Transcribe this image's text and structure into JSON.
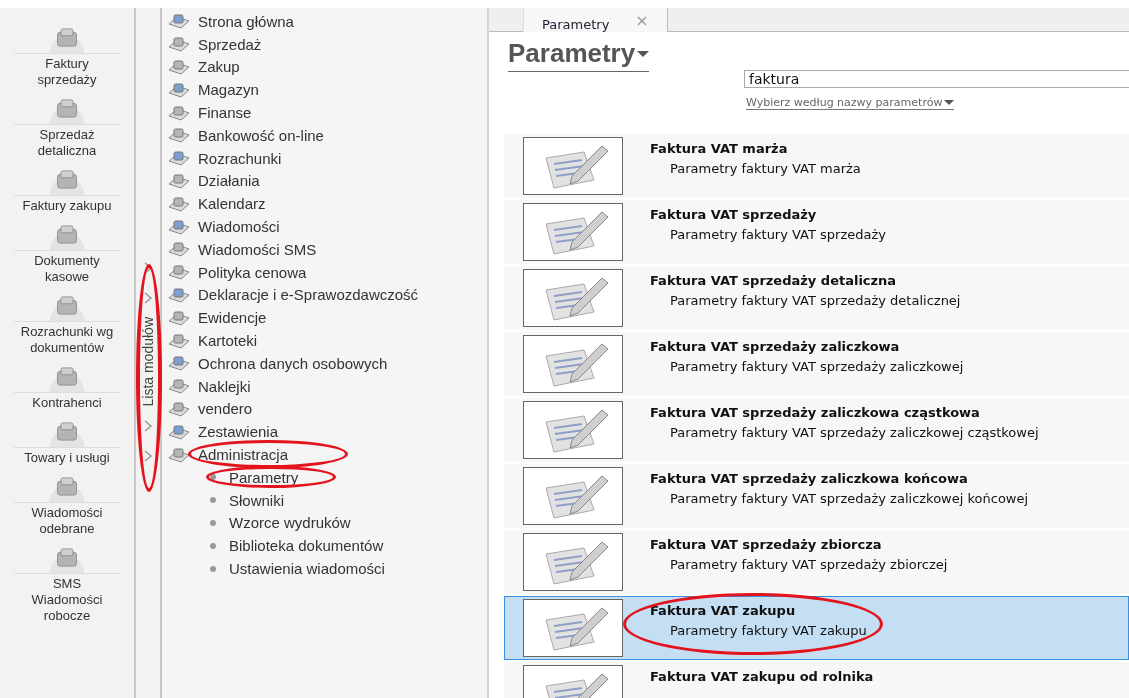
{
  "rail": {
    "items": [
      {
        "label": "Faktury\nsprzedaży"
      },
      {
        "label": "Sprzedaż\ndetaliczna"
      },
      {
        "label": "Faktury zakupu"
      },
      {
        "label": "Dokumenty\nkasowe"
      },
      {
        "label": "Rozrachunki wg\ndokumentów"
      },
      {
        "label": "Kontrahenci"
      },
      {
        "label": "Towary i usługi"
      },
      {
        "label": "Wiadomości\nodebrane"
      },
      {
        "label": "SMS\nWiadomości\nrobocze"
      }
    ]
  },
  "module_list": {
    "label": "Lista modułów",
    "highlighted": true
  },
  "tree": {
    "items": [
      {
        "label": "Strona główna",
        "highlighted": false
      },
      {
        "label": "Sprzedaż",
        "highlighted": false
      },
      {
        "label": "Zakup",
        "highlighted": false
      },
      {
        "label": "Magazyn",
        "highlighted": false
      },
      {
        "label": "Finanse",
        "highlighted": false
      },
      {
        "label": "Bankowość on-line",
        "highlighted": false
      },
      {
        "label": "Rozrachunki",
        "highlighted": false
      },
      {
        "label": "Działania",
        "highlighted": false
      },
      {
        "label": "Kalendarz",
        "highlighted": false
      },
      {
        "label": "Wiadomości",
        "highlighted": false
      },
      {
        "label": "Wiadomości SMS",
        "highlighted": false
      },
      {
        "label": "Polityka cenowa",
        "highlighted": false
      },
      {
        "label": "Deklaracje i e-Sprawozdawczość",
        "highlighted": false
      },
      {
        "label": "Ewidencje",
        "highlighted": false
      },
      {
        "label": "Kartoteki",
        "highlighted": false
      },
      {
        "label": "Ochrona danych osobowych",
        "highlighted": false
      },
      {
        "label": "Naklejki",
        "highlighted": false
      },
      {
        "label": "vendero",
        "highlighted": false
      },
      {
        "label": "Zestawienia",
        "highlighted": false
      },
      {
        "label": "Administracja",
        "highlighted": true,
        "children": [
          {
            "label": "Parametry",
            "highlighted": true
          },
          {
            "label": "Słowniki",
            "highlighted": false
          },
          {
            "label": "Wzorce wydruków",
            "highlighted": false
          },
          {
            "label": "Biblioteka dokumentów",
            "highlighted": false
          },
          {
            "label": "Ustawienia wiadomości",
            "highlighted": false
          }
        ]
      }
    ]
  },
  "tabs": [
    {
      "label": "Parametry",
      "selected": true,
      "close": "×"
    }
  ],
  "page": {
    "title": "Parametry",
    "search": {
      "value": "faktura"
    },
    "filter_link": "Wybierz według nazwy parametrów"
  },
  "results": [
    {
      "title": "Faktura VAT marża",
      "description": "Parametry faktury VAT marża",
      "selected": false,
      "highlighted": false
    },
    {
      "title": "Faktura VAT sprzedaży",
      "description": "Parametry faktury VAT sprzedaży",
      "selected": false,
      "highlighted": false
    },
    {
      "title": "Faktura VAT sprzedaży detaliczna",
      "description": "Parametry faktury VAT sprzedaży detalicznej",
      "selected": false,
      "highlighted": false
    },
    {
      "title": "Faktura VAT sprzedaży zaliczkowa",
      "description": "Parametry faktury VAT sprzedaży zaliczkowej",
      "selected": false,
      "highlighted": false
    },
    {
      "title": "Faktura VAT sprzedaży zaliczkowa cząstkowa",
      "description": "Parametry faktury VAT sprzedaży zaliczkowej cząstkowej",
      "selected": false,
      "highlighted": false
    },
    {
      "title": "Faktura VAT sprzedaży zaliczkowa końcowa",
      "description": "Parametry faktury VAT sprzedaży zaliczkowej końcowej",
      "selected": false,
      "highlighted": false
    },
    {
      "title": "Faktura VAT sprzedaży zbiorcza",
      "description": "Parametry faktury VAT sprzedaży zbiorczej",
      "selected": false,
      "highlighted": false
    },
    {
      "title": "Faktura VAT zakupu",
      "description": "Parametry faktury VAT zakupu",
      "selected": true,
      "highlighted": true
    },
    {
      "title": "Faktura VAT zakupu od rolnika",
      "selected": false,
      "highlighted": false
    }
  ]
}
